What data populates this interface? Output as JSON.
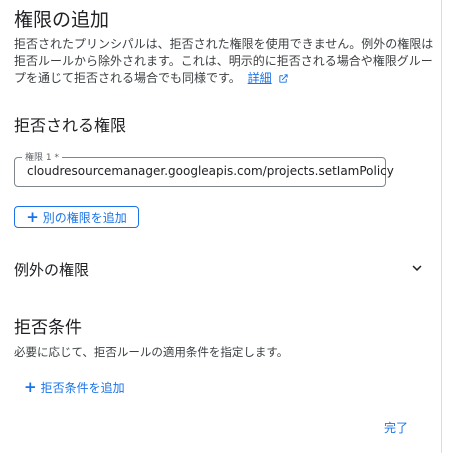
{
  "header": {
    "title": "権限の追加",
    "description": "拒否されたプリンシパルは、拒否された権限を使用できません。例外の権限は拒否ルールから除外されます。これは、明示的に拒否される場合や権限グループを通じて拒否される場合でも同様です。",
    "link_label": "詳細"
  },
  "denied_permissions": {
    "title": "拒否される権限",
    "field_label": "権限 1 *",
    "field_value": "cloudresourcemanager.googleapis.com/projects.setIamPolicy",
    "add_button_label": "別の権限を追加"
  },
  "exceptions": {
    "title": "例外の権限"
  },
  "conditions": {
    "title": "拒否条件",
    "description": "必要に応じて、拒否ルールの適用条件を指定します。",
    "add_label": "拒否条件を追加"
  },
  "footer": {
    "done_label": "完了"
  },
  "colors": {
    "accent": "#1a73e8",
    "text": "#202124",
    "secondary_text": "#3c4043",
    "border": "#80868b"
  }
}
